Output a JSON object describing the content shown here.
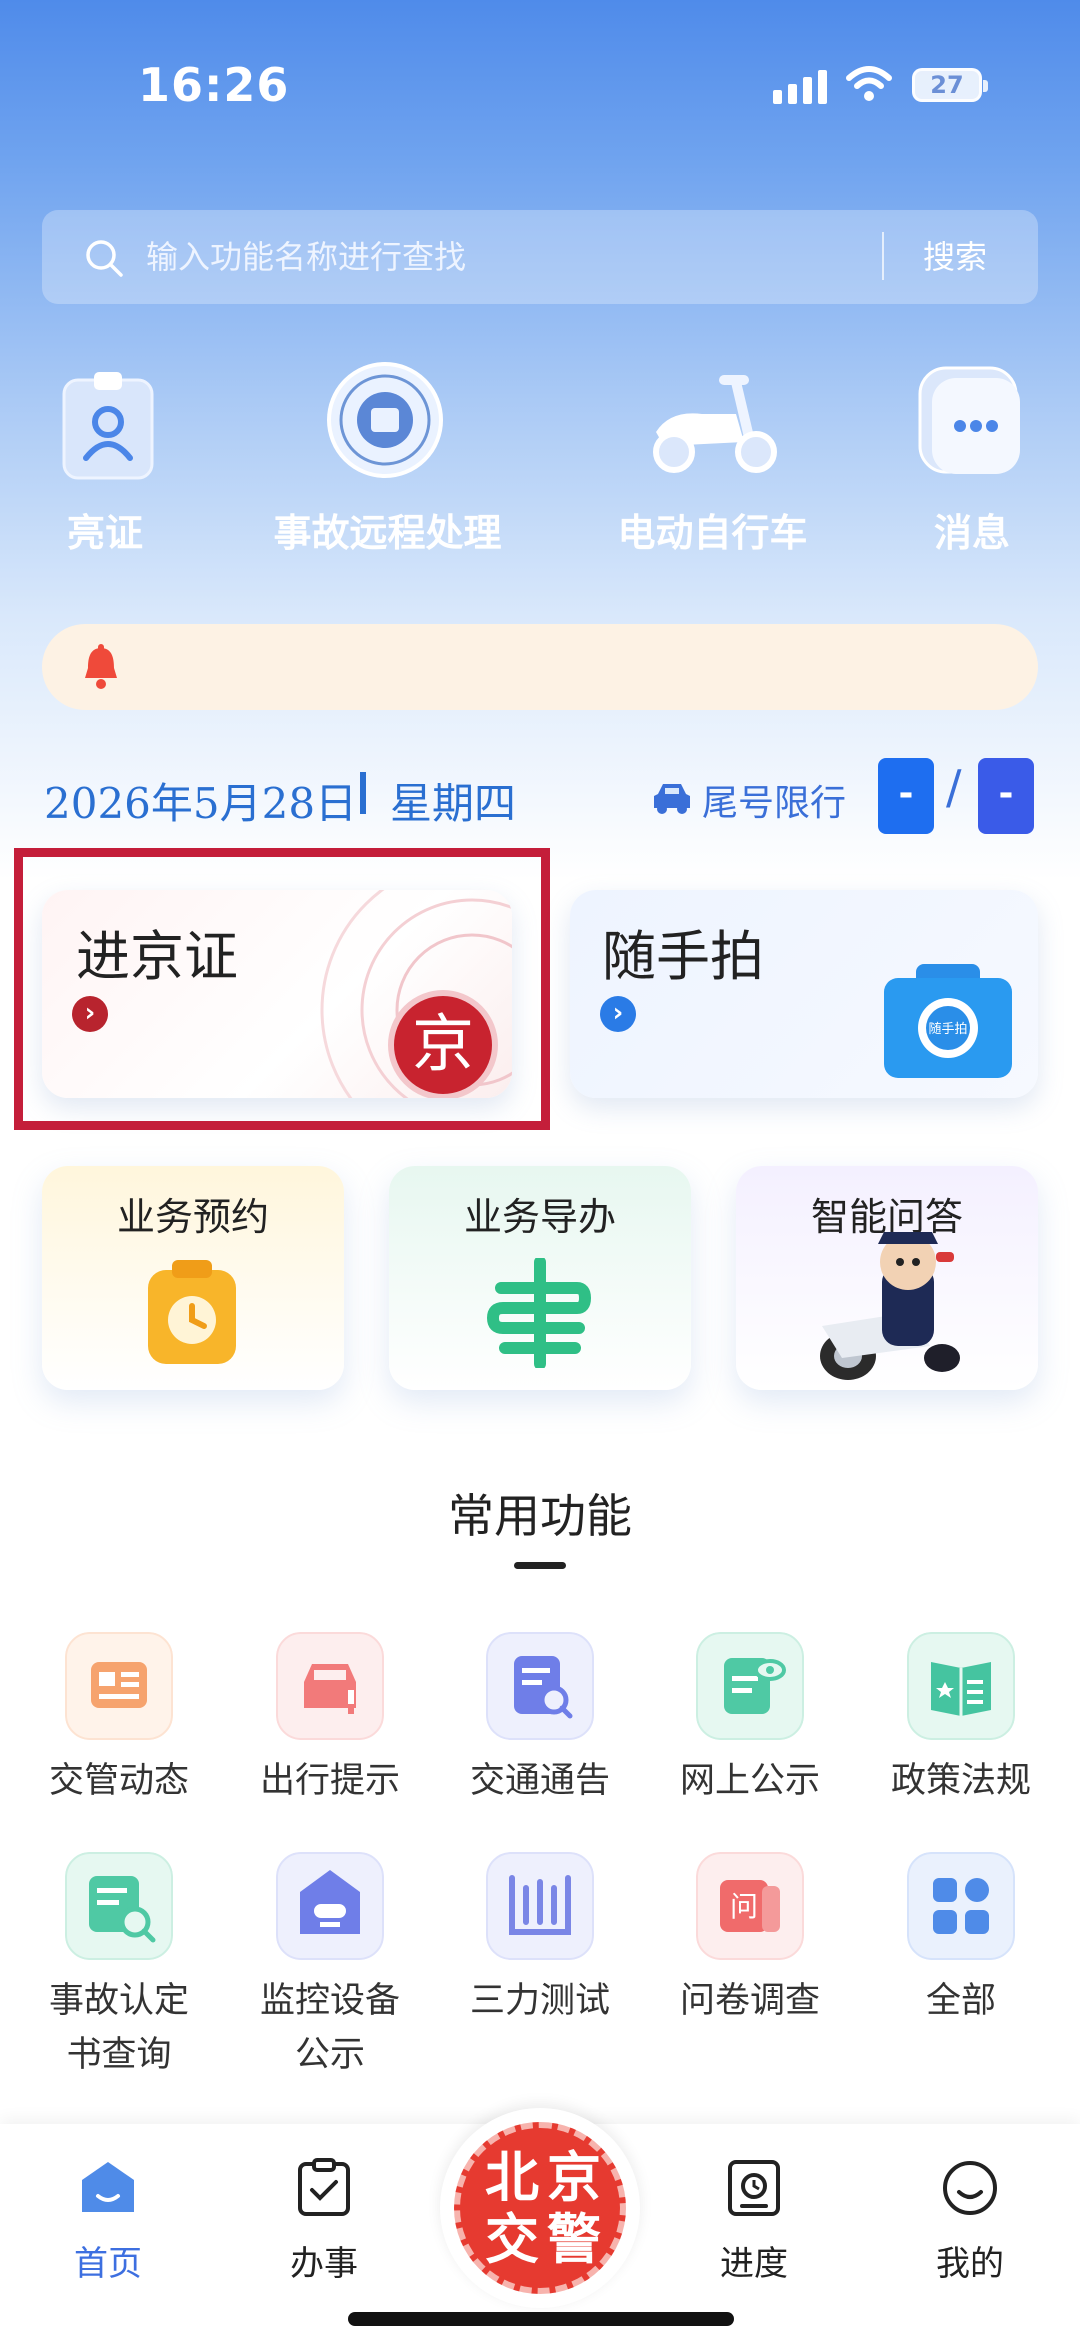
{
  "status_bar": {
    "time": "16:26",
    "battery": "27"
  },
  "search": {
    "placeholder": "输入功能名称进行查找",
    "button": "搜索"
  },
  "quick_actions": [
    {
      "label": "亮证",
      "icon": "id-badge-icon"
    },
    {
      "label": "事故远程处理",
      "icon": "police-emblem-icon"
    },
    {
      "label": "电动自行车",
      "icon": "e-scooter-icon"
    },
    {
      "label": "消息",
      "icon": "message-icon"
    }
  ],
  "notice": {
    "icon": "bell-icon",
    "text": ""
  },
  "date_row": {
    "date": "2026年5月28日",
    "weekday": "星期四",
    "limit_label": "尾号限行",
    "limit_1": "-",
    "limit_2": "-"
  },
  "cards": {
    "entry_permit": {
      "title": "进京证",
      "logo_char": "京"
    },
    "snapshot": {
      "title": "随手拍",
      "camera_label": "随手拍"
    }
  },
  "mid_cards": [
    {
      "label": "业务预约",
      "icon": "clipboard-clock-icon"
    },
    {
      "label": "业务导办",
      "icon": "guide-icon"
    },
    {
      "label": "智能问答",
      "icon": "police-mascot-icon"
    }
  ],
  "section_title": "常用功能",
  "functions": [
    {
      "label": "交管动态",
      "icon": "news-icon",
      "color": "#f6a36e"
    },
    {
      "label": "出行提示",
      "icon": "car-alert-icon",
      "color": "#f27a7a"
    },
    {
      "label": "交通通告",
      "icon": "doc-search-icon",
      "color": "#6f7ee8"
    },
    {
      "label": "网上公示",
      "icon": "doc-eye-icon",
      "color": "#4fc9a4"
    },
    {
      "label": "政策法规",
      "icon": "law-book-icon",
      "color": "#45c4a0"
    },
    {
      "label": "事故认定",
      "label2": "书查询",
      "icon": "report-search-icon",
      "color": "#4fc9a4"
    },
    {
      "label": "监控设备",
      "label2": "公示",
      "icon": "monitor-icon",
      "color": "#6f7ee8"
    },
    {
      "label": "三力测试",
      "icon": "test-icon",
      "color": "#7a86e6"
    },
    {
      "label": "问卷调查",
      "icon": "survey-icon",
      "color": "#f06b6b"
    },
    {
      "label": "全部",
      "icon": "all-grid-icon",
      "color": "#4f8be8"
    }
  ],
  "bottom_nav": {
    "home": "首页",
    "tasks": "办事",
    "center_logo": [
      "北",
      "京",
      "交",
      "警"
    ],
    "progress": "进度",
    "mine": "我的"
  },
  "colors": {
    "accent": "#2a6fd1",
    "permit_red": "#c41e3a",
    "nav_active": "#3d6fe0"
  }
}
